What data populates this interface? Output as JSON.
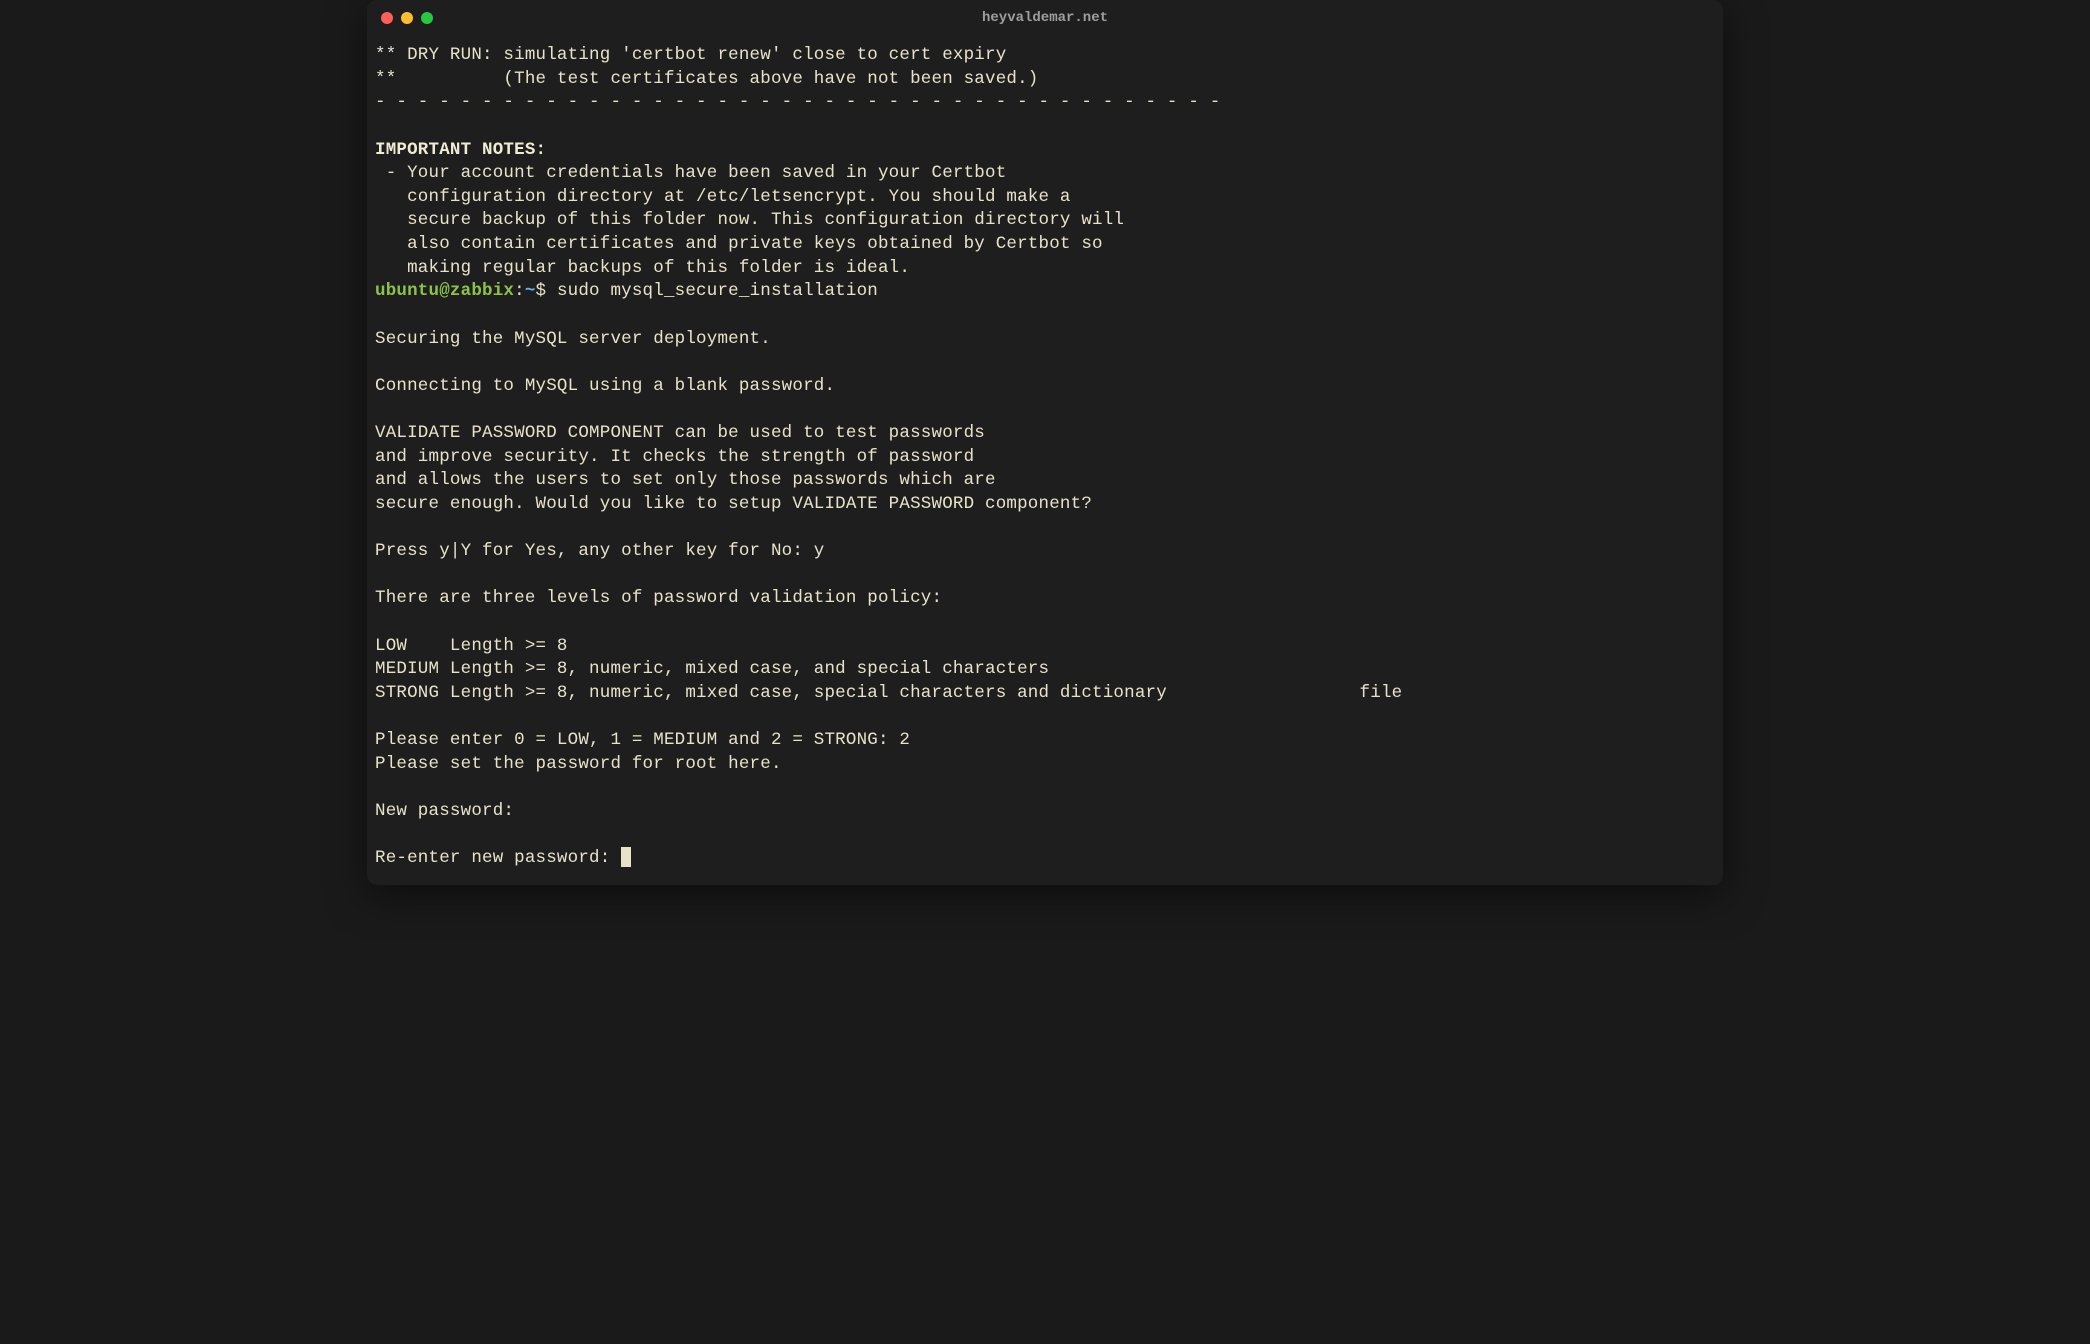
{
  "window": {
    "title": "heyvaldemar.net"
  },
  "terminal": {
    "dry_run_l1": "** DRY RUN: simulating 'certbot renew' close to cert expiry",
    "dry_run_l2": "**          (The test certificates above have not been saved.)",
    "dashes": "- - - - - - - - - - - - - - - - - - - - - - - - - - - - - - - - - - - - - - - -",
    "important_heading": "IMPORTANT NOTES:",
    "note_l1": " - Your account credentials have been saved in your Certbot",
    "note_l2": "   configuration directory at /etc/letsencrypt. You should make a",
    "note_l3": "   secure backup of this folder now. This configuration directory will",
    "note_l4": "   also contain certificates and private keys obtained by Certbot so",
    "note_l5": "   making regular backups of this folder is ideal.",
    "prompt_user": "ubuntu@zabbix",
    "prompt_sep": ":",
    "prompt_path": "~",
    "prompt_dollar": "$ ",
    "command": "sudo mysql_secure_installation",
    "securing": "Securing the MySQL server deployment.",
    "connecting": "Connecting to MySQL using a blank password.",
    "validate_l1": "VALIDATE PASSWORD COMPONENT can be used to test passwords",
    "validate_l2": "and improve security. It checks the strength of password",
    "validate_l3": "and allows the users to set only those passwords which are",
    "validate_l4": "secure enough. Would you like to setup VALIDATE PASSWORD component?",
    "press_y": "Press y|Y for Yes, any other key for No: y",
    "three_levels": "There are three levels of password validation policy:",
    "low": "LOW    Length >= 8",
    "medium": "MEDIUM Length >= 8, numeric, mixed case, and special characters",
    "strong": "STRONG Length >= 8, numeric, mixed case, special characters and dictionary                  file",
    "enter_level": "Please enter 0 = LOW, 1 = MEDIUM and 2 = STRONG: 2",
    "set_password": "Please set the password for root here.",
    "new_password": "New password: ",
    "reenter": "Re-enter new password: "
  }
}
